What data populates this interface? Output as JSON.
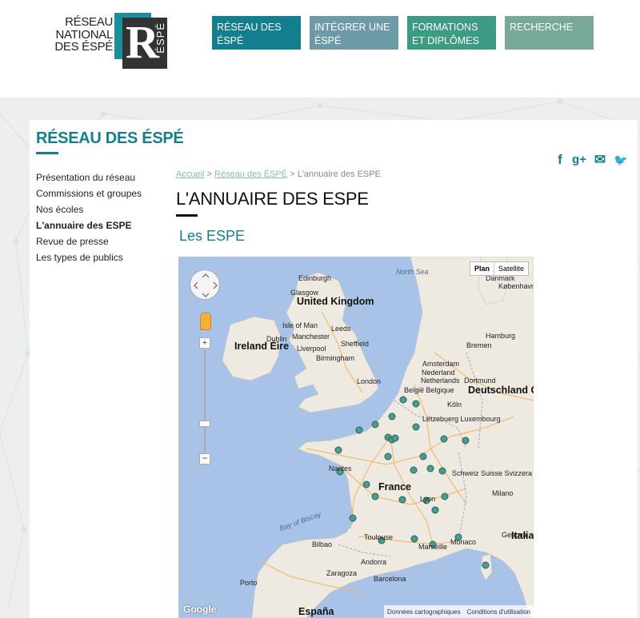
{
  "logo": {
    "line1": "RÉSEAU",
    "line2": "NATIONAL",
    "line3": "DES ÉSPÉ",
    "letter": "R",
    "vertical": "ÉSPÉ"
  },
  "nav": {
    "items": [
      {
        "label": "RÉSEAU DES ÉSPÉ"
      },
      {
        "label": "INTÉGRER UNE ÉSPÉ"
      },
      {
        "label": "FORMATIONS ET DIPLÔMES"
      },
      {
        "label": "RECHERCHE"
      }
    ]
  },
  "section": {
    "title": "RÉSEAU DES ÉSPÉ"
  },
  "share": {
    "facebook": "f",
    "gplus": "g+",
    "email": "✉",
    "twitter": "🐦"
  },
  "sidenav": {
    "items": [
      {
        "label": "Présentation du réseau"
      },
      {
        "label": "Commissions et groupes"
      },
      {
        "label": "Nos écoles"
      },
      {
        "label": "L'annuaire des ESPE"
      },
      {
        "label": "Revue de presse"
      },
      {
        "label": "Les types de publics"
      }
    ]
  },
  "breadcrumb": {
    "home": "Accueil",
    "sep1": " > ",
    "parent": "Réseau des ÉSPÉ",
    "sep2": " > ",
    "current": "L'annuaire des ESPE"
  },
  "page": {
    "title": "L'ANNUAIRE DES ESPE",
    "subtitle": "Les ESPE"
  },
  "map": {
    "type_plan": "Plan",
    "type_satellite": "Satellite",
    "zoom_plus": "+",
    "zoom_minus": "−",
    "google": "Google",
    "footer_data": "Données cartographiques",
    "footer_terms": "Conditions d'utilisation",
    "labels": {
      "north_sea": "North Sea",
      "edinburgh": "Edinburgh",
      "glasgow": "Glasgow",
      "uk": "United Kingdom",
      "isle_of_man": "Isle of Man",
      "leeds": "Leeds",
      "manchester": "Manchester",
      "liverpool": "Liverpool",
      "sheffield": "Sheffield",
      "dublin": "Dublin",
      "ireland": "Ireland Éire",
      "birmingham": "Birmingham",
      "london": "London",
      "denmark": "Danmark",
      "kobenhavn": "København",
      "hamburg": "Hamburg",
      "bremen": "Bremen",
      "nederland": "Nederland",
      "netherlands": "Netherlands",
      "amsterdam": "Amsterdam",
      "dortmund": "Dortmund",
      "deutschland": "Deutschland Germany",
      "belgie": "België Belgique",
      "koln": "Köln",
      "letzebuerg": "Lëtzebuerg Luxembourg",
      "france": "France",
      "nantes": "Nantes",
      "lyon": "Lyon",
      "schweiz": "Schweiz Suisse Svizzera Switzerland",
      "milano": "Milano",
      "genova": "Genova",
      "bay_biscay": "Bay of Biscay",
      "bilbao": "Bilbao",
      "toulouse": "Toulouse",
      "marseille": "Marseille",
      "monaco": "Monaco",
      "andorra": "Andorra",
      "zaragoza": "Zaragoza",
      "barcelona": "Barcelona",
      "porto": "Porto",
      "espana": "España",
      "italia": "Italia Italy"
    }
  }
}
